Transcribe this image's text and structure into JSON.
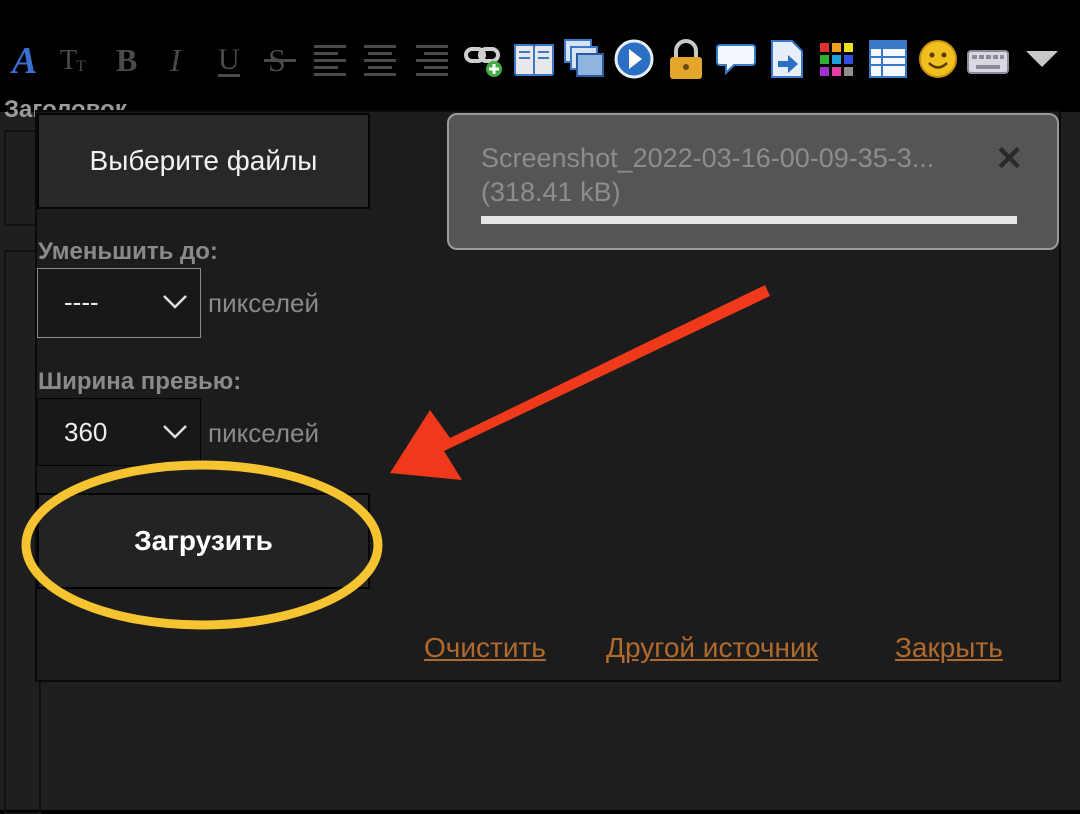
{
  "toolbar": {
    "icons": [
      "font-style-icon",
      "font-size-icon",
      "bold-icon",
      "italic-icon",
      "underline-icon",
      "strikethrough-icon",
      "align-left-icon",
      "align-center-icon",
      "align-right-icon",
      "insert-link-icon",
      "book-icon",
      "image-gallery-icon",
      "media-play-icon",
      "lock-icon",
      "comment-icon",
      "image-upload-icon",
      "color-palette-icon",
      "table-icon",
      "smiley-icon",
      "keyboard-icon",
      "more-dropdown-icon"
    ]
  },
  "behind": {
    "title_label": "Заголовок"
  },
  "dialog": {
    "choose_files": "Выберите файлы",
    "resize_label": "Уменьшить до:",
    "resize_value": "----",
    "preview_label": "Ширина превью:",
    "preview_value": "360",
    "pixels_unit": "пикселей",
    "upload": "Загрузить",
    "file": {
      "name": "Screenshot_2022-03-16-00-09-35-3...",
      "size": "(318.41 kB)",
      "progress": 1.0
    },
    "links": {
      "clear": "Очистить",
      "other_source": "Другой источник",
      "close": "Закрыть"
    }
  },
  "colors": {
    "link": "#b06a2e",
    "annotation_arrow": "#f0391b",
    "annotation_ellipse": "#f6c431"
  }
}
